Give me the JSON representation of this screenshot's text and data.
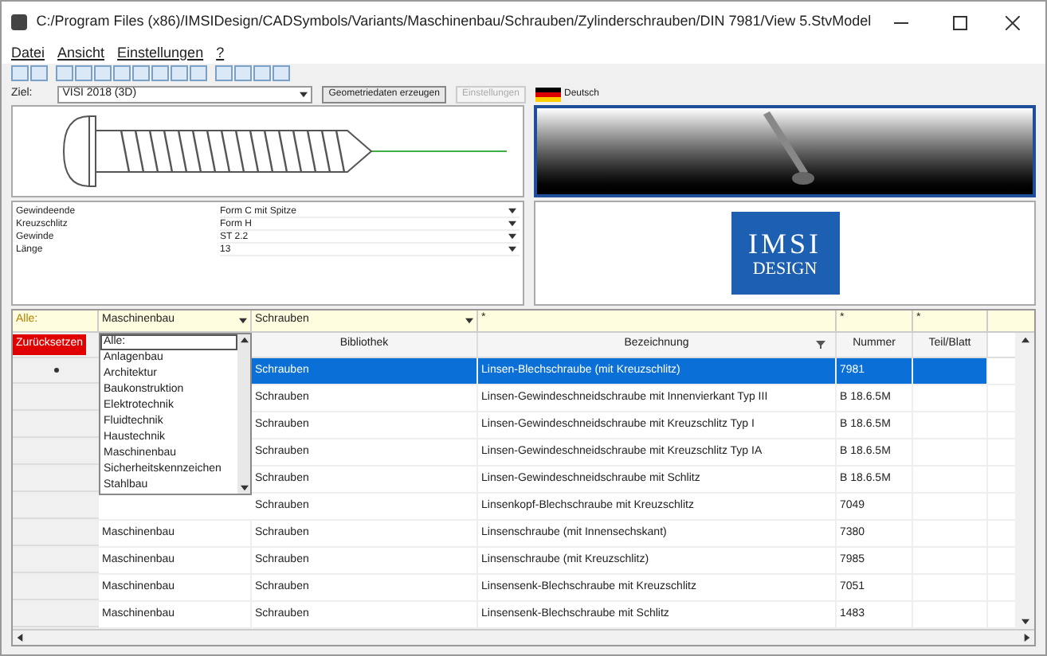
{
  "window": {
    "title": "C:/Program Files (x86)/IMSIDesign/CADSymbols/Variants/Maschinenbau/Schrauben/Zylinderschrauben/DIN 7981/View 5.StvModel"
  },
  "menu": [
    "Datei",
    "Ansicht",
    "Einstellungen",
    "?"
  ],
  "target": {
    "label": "Ziel:",
    "value": "VISI 2018 (3D)",
    "language": "Deutsch",
    "buttons": [
      {
        "label": "Geometriedaten erzeugen",
        "disabled": false
      },
      {
        "label": "Einstellungen",
        "disabled": true
      }
    ]
  },
  "properties": [
    {
      "name": "Gewindeende",
      "value": "Form C mit Spitze"
    },
    {
      "name": "Kreuzschlitz",
      "value": "Form H"
    },
    {
      "name": "Gewinde",
      "value": "ST 2.2"
    },
    {
      "name": "Länge",
      "value": "13"
    }
  ],
  "logo": {
    "line_1": "IMSI",
    "line_2": "DESIGN"
  },
  "filters": {
    "label": "Alle:",
    "catalog": "Maschinenbau",
    "library": "Schrauben",
    "description": "*",
    "number": "*",
    "sheet": "*"
  },
  "reset_button": "Zurücksetzen",
  "catalog_dropdown": [
    {
      "label": "Alle:",
      "selected": true
    },
    {
      "label": "Anlagenbau",
      "selected": false
    },
    {
      "label": "Architektur",
      "selected": false
    },
    {
      "label": "Baukonstruktion",
      "selected": false
    },
    {
      "label": "Elektrotechnik",
      "selected": false
    },
    {
      "label": "Fluidtechnik",
      "selected": false
    },
    {
      "label": "Haustechnik",
      "selected": false
    },
    {
      "label": "Maschinenbau",
      "selected": false
    },
    {
      "label": "Sicherheitskennzeichen",
      "selected": false
    },
    {
      "label": "Stahlbau",
      "selected": false
    }
  ],
  "table": {
    "columns": [
      "Bibliothek",
      "Bezeichnung",
      "Nummer",
      "Teil/Blatt"
    ],
    "rows": [
      {
        "library": "Schrauben",
        "name": "Linsen-Blechschraube (mit Kreuzschlitz)",
        "number": "7981",
        "selected": true
      },
      {
        "library": "Schrauben",
        "name": "Linsen-Gewindeschneidschraube mit Innenvierkant Typ III",
        "number": "B 18.6.5M",
        "selected": false
      },
      {
        "library": "Schrauben",
        "name": "Linsen-Gewindeschneidschraube mit Kreuzschlitz Typ I",
        "number": "B 18.6.5M",
        "selected": false
      },
      {
        "library": "Schrauben",
        "name": "Linsen-Gewindeschneidschraube mit Kreuzschlitz Typ IA",
        "number": "B 18.6.5M",
        "selected": false
      },
      {
        "library": "Schrauben",
        "name": "Linsen-Gewindeschneidschraube mit Schlitz",
        "number": "B 18.6.5M",
        "selected": false
      },
      {
        "library": "Schrauben",
        "name": "Linsenkopf-Blechschraube mit Kreuzschlitz",
        "number": "7049",
        "selected": false
      },
      {
        "catalog": "Maschinenbau",
        "library": "Schrauben",
        "name": "Linsenschraube (mit Innensechskant)",
        "number": "7380",
        "selected": false
      },
      {
        "catalog": "Maschinenbau",
        "library": "Schrauben",
        "name": "Linsenschraube (mit Kreuzschlitz)",
        "number": "7985",
        "selected": false
      },
      {
        "catalog": "Maschinenbau",
        "library": "Schrauben",
        "name": "Linsensenk-Blechschraube mit Kreuzschlitz",
        "number": "7051",
        "selected": false
      },
      {
        "catalog": "Maschinenbau",
        "library": "Schrauben",
        "name": "Linsensenk-Blechschraube mit Schlitz",
        "number": "1483",
        "selected": false
      }
    ]
  }
}
